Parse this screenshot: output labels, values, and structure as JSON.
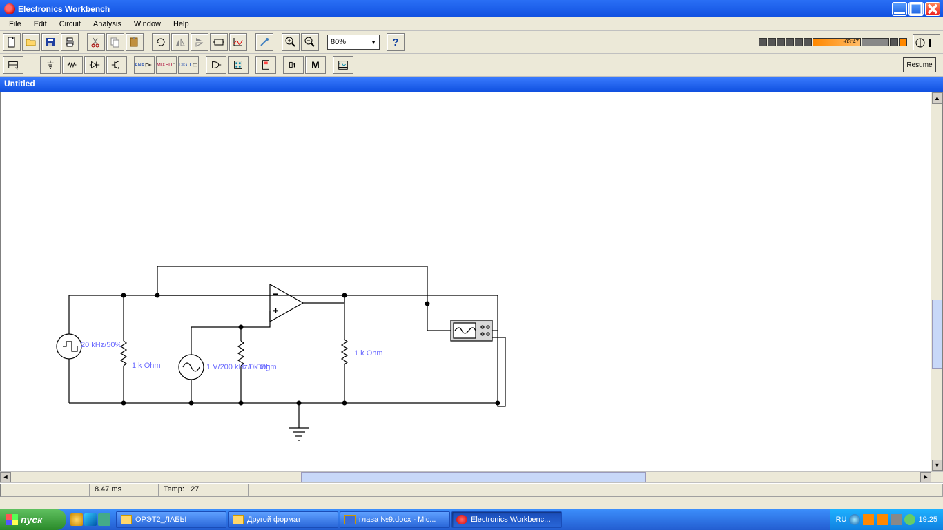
{
  "app": {
    "title": "Electronics Workbench"
  },
  "menu": [
    "File",
    "Edit",
    "Circuit",
    "Analysis",
    "Window",
    "Help"
  ],
  "toolbar": {
    "zoom": "80%"
  },
  "mediabar": {
    "time": "-03:47"
  },
  "resume_label": "Resume",
  "document": {
    "title": "Untitled"
  },
  "circuit": {
    "source1": "20 kHz/50%",
    "r1": "1 k Ohm",
    "source2": "1 V/200 kHz/0 Deg",
    "r2_overlap": "1 k Ohm",
    "r3": "1 k Ohm"
  },
  "status": {
    "time": "8.47 ms",
    "temp_label": "Temp:",
    "temp_value": "27"
  },
  "taskbar": {
    "start": "пуск",
    "items": [
      {
        "label": "ОРЭТ2_ЛАБЫ"
      },
      {
        "label": "Другой формат"
      },
      {
        "label": "глава №9.docx - Mic..."
      },
      {
        "label": "Electronics Workbenc..."
      }
    ],
    "lang": "RU",
    "clock": "19:25"
  }
}
